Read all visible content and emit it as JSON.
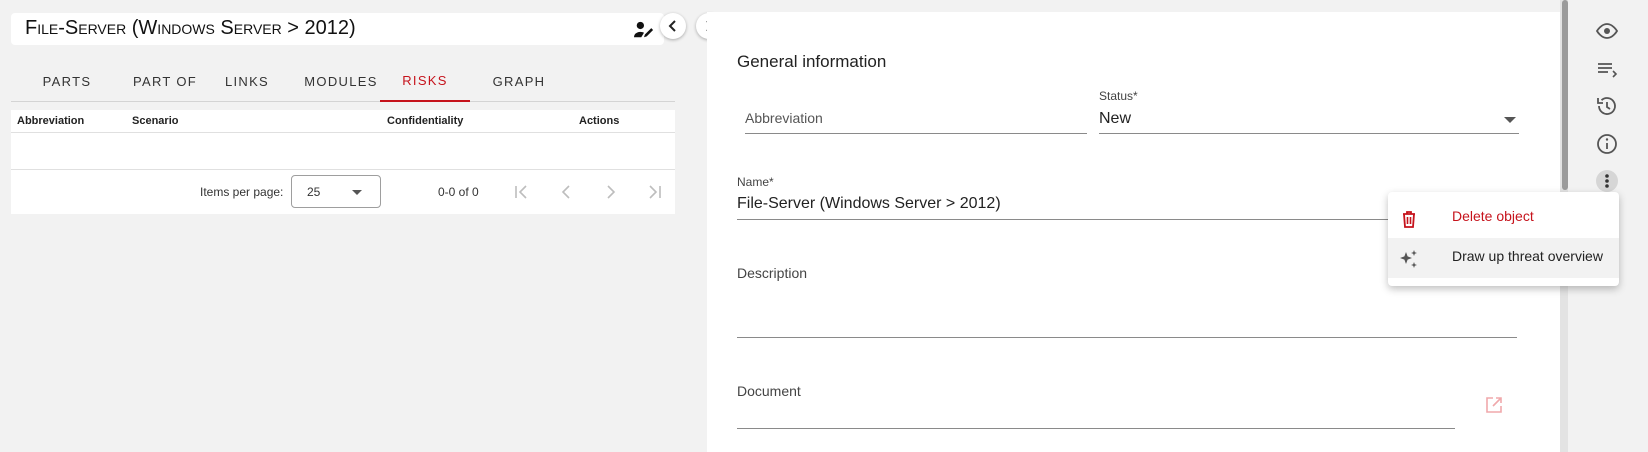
{
  "object": {
    "title": "File-Server (Windows Server > 2012)",
    "edit_icon": "person-edit-icon"
  },
  "nav": {
    "prev_icon": "chevron-left-icon",
    "next_icon": "chevron-right-icon"
  },
  "tabs": [
    {
      "label": "PARTS"
    },
    {
      "label": "PART OF"
    },
    {
      "label": "LINKS"
    },
    {
      "label": "MODULES"
    },
    {
      "label": "RISKS",
      "active": true
    },
    {
      "label": "GRAPH"
    }
  ],
  "table": {
    "columns": [
      "Abbreviation",
      "Scenario",
      "Confidentiality",
      "Actions"
    ],
    "rows": []
  },
  "paginator": {
    "items_per_page_label": "Items per page:",
    "page_size": "25",
    "range_label": "0-0 of 0"
  },
  "form": {
    "section_title": "General information",
    "abbreviation": {
      "placeholder": "Abbreviation",
      "value": ""
    },
    "status": {
      "label": "Status*",
      "value": "New"
    },
    "name": {
      "label": "Name*",
      "value": "File-Server (Windows Server > 2012)"
    },
    "description": {
      "label": "Description",
      "value": ""
    },
    "document": {
      "label": "Document",
      "value": ""
    }
  },
  "context_menu": {
    "items": [
      {
        "label": "Delete object",
        "icon": "trash-icon",
        "color": "#c6131c"
      },
      {
        "label": "Draw up threat overview",
        "icon": "sparkle-icon",
        "color": "#222222"
      }
    ]
  },
  "rail": {
    "icons": [
      "eye-icon",
      "list-icon",
      "history-icon",
      "info-icon",
      "more-vertical-icon"
    ]
  },
  "colors": {
    "accent": "#c6131c",
    "background": "#f2f2f2",
    "surface": "#ffffff"
  }
}
